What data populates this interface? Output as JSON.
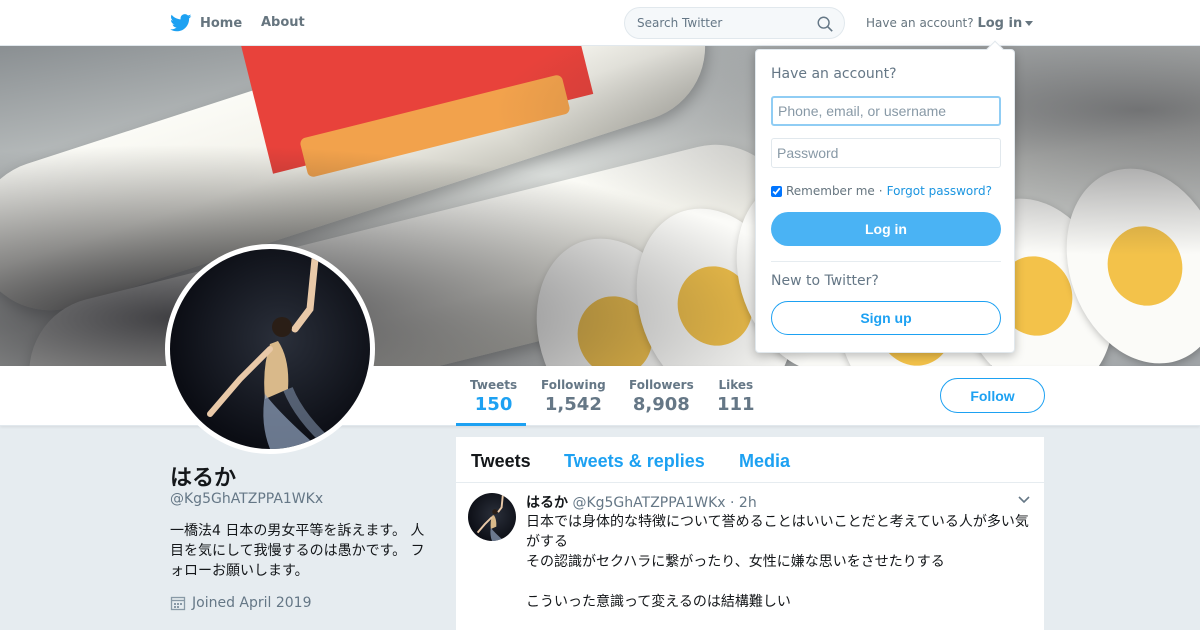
{
  "nav": {
    "home_label": "Home",
    "about_label": "About",
    "search_placeholder": "Search Twitter",
    "have_account_text": "Have an account?",
    "login_label": "Log in"
  },
  "profile": {
    "name": "はるか",
    "handle": "@Kg5GhATZPPA1WKx",
    "bio": "一橋法4 日本の男女平等を訴えます。 人目を気にして我慢するのは愚かです。 フォローお願いします。",
    "joined": "Joined April 2019"
  },
  "stats": [
    {
      "label": "Tweets",
      "value": "150"
    },
    {
      "label": "Following",
      "value": "1,542"
    },
    {
      "label": "Followers",
      "value": "8,908"
    },
    {
      "label": "Likes",
      "value": "111"
    }
  ],
  "follow_label": "Follow",
  "timeline": {
    "tabs": [
      {
        "label": "Tweets"
      },
      {
        "label": "Tweets & replies"
      },
      {
        "label": "Media"
      }
    ],
    "tweet": {
      "name": "はるか",
      "handle": "@Kg5GhATZPPA1WKx",
      "time": "· 2h",
      "lines": [
        "日本では身体的な特徴について誉めることはいいことだと考えている人が多い気がする",
        "その認識がセクハラに繋がったり、女性に嫌な思いをさせたりする",
        "",
        "こういった意識って変えるのは結構難しい"
      ]
    }
  },
  "login": {
    "title": "Have an account?",
    "username_placeholder": "Phone, email, or username",
    "password_placeholder": "Password",
    "remember_label": "Remember me",
    "separator": "·",
    "forgot_label": "Forgot password?",
    "login_button": "Log in",
    "new_to": "New to Twitter?",
    "signup_button": "Sign up"
  },
  "colors": {
    "accent": "#1da1f2",
    "login_button": "#4ab3f4",
    "background": "#e6ecf0"
  }
}
